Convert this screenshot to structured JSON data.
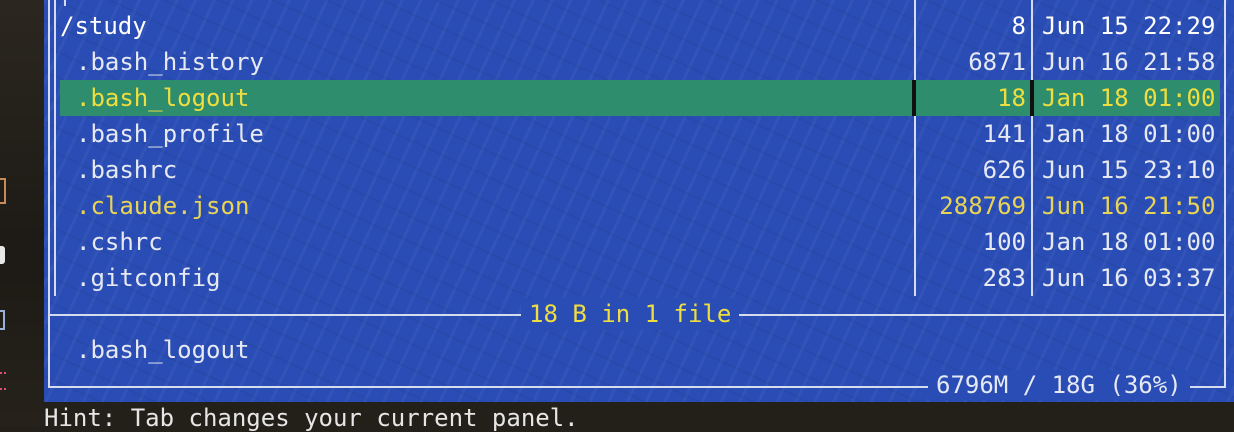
{
  "panel": {
    "path": "/study",
    "path_size": "8",
    "path_date": "Jun 15 22:29",
    "files": [
      {
        "name": ".bash_history",
        "size": "6871",
        "date": "Jun 16 21:58",
        "state": "normal"
      },
      {
        "name": ".bash_logout",
        "size": "18",
        "date": "Jan 18 01:00",
        "state": "selected"
      },
      {
        "name": ".bash_profile",
        "size": "141",
        "date": "Jan 18 01:00",
        "state": "normal"
      },
      {
        "name": ".bashrc",
        "size": "626",
        "date": "Jun 15 23:10",
        "state": "normal"
      },
      {
        "name": ".claude.json",
        "size": "288769",
        "date": "Jun 16 21:50",
        "state": "highlighted"
      },
      {
        "name": ".cshrc",
        "size": "100",
        "date": "Jan 18 01:00",
        "state": "normal"
      },
      {
        "name": ".gitconfig",
        "size": "283",
        "date": "Jun 16 03:37",
        "state": "normal"
      }
    ],
    "selection_status": "18 B in 1 file",
    "mini_status": ".bash_logout",
    "disk_usage": "6796M / 18G (36%)"
  },
  "hint": "Hint: Tab changes your current panel.",
  "colors": {
    "panel_bg": "#2a4db5",
    "cursor_bg": "#2e8d6d",
    "cursor_fg": "#f0de3e",
    "highlight_fg": "#e9d455",
    "text_fg": "#e6e9f2",
    "frame": "#d5dcf0"
  }
}
